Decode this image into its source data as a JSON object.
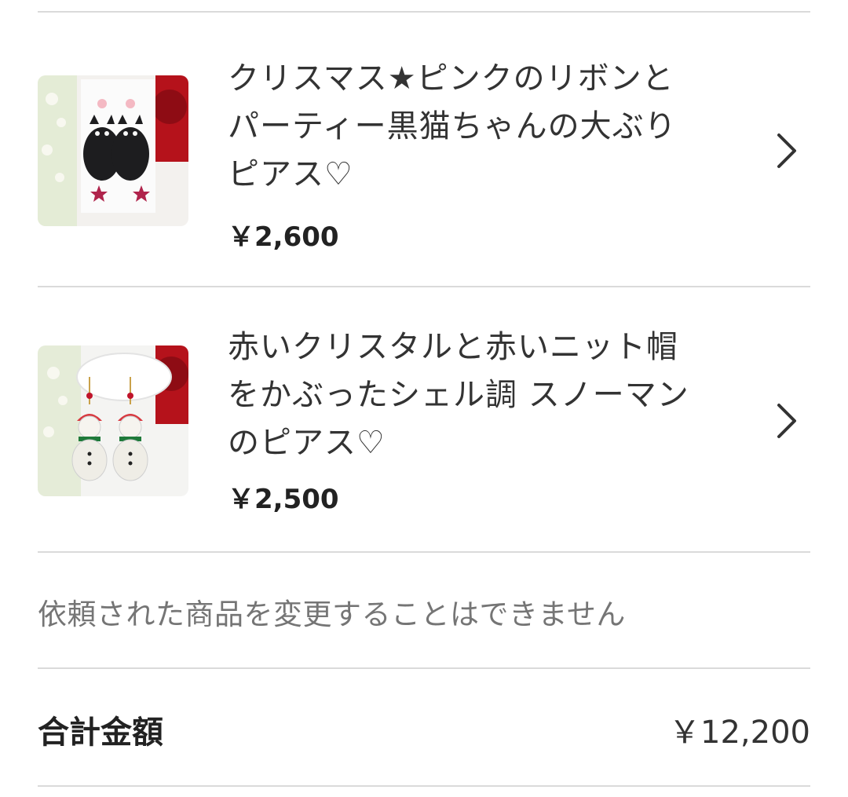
{
  "items": [
    {
      "title_lines": [
        "クリスマス★ピンクのリボンと",
        "パーティー黒猫ちゃんの大ぶり",
        "ピアス♡"
      ],
      "price": "￥2,600",
      "thumbnail": "black-cat-earrings-photo",
      "chevron": "chevron-right-icon"
    },
    {
      "title_lines": [
        "赤いクリスタルと赤いニット帽",
        "をかぶったシェル調 スノーマン",
        "のピアス♡"
      ],
      "price": "￥2,500",
      "thumbnail": "snowman-earrings-photo",
      "chevron": "chevron-right-icon"
    }
  ],
  "notice": "依頼された商品を変更することはできません",
  "total": {
    "label": "合計金額",
    "value": "￥12,200"
  }
}
